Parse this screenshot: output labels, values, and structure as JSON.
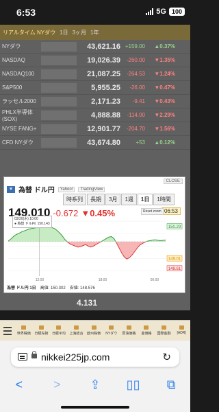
{
  "status": {
    "time": "6:53",
    "network": "5G",
    "battery": "100"
  },
  "background": {
    "header": {
      "title": "リアルタイム NYダウ",
      "options": [
        "1日",
        "3ヶ月",
        "1年"
      ]
    },
    "rows": [
      {
        "name": "NYダウ",
        "price": "43,621.16",
        "change": "+159.00",
        "pct": "▲0.37%",
        "dir": "up"
      },
      {
        "name": "NASDAQ",
        "price": "19,026.39",
        "change": "-260.00",
        "pct": "▼1.35%",
        "dir": "dn"
      },
      {
        "name": "NASDAQ100",
        "price": "21,087.25",
        "change": "-264.53",
        "pct": "▼1.24%",
        "dir": "dn"
      },
      {
        "name": "S&P500",
        "price": "5,955.25",
        "change": "-26.00",
        "pct": "▼0.47%",
        "dir": "dn"
      },
      {
        "name": "ラッセル2000",
        "price": "2,171.23",
        "change": "-9.41",
        "pct": "▼0.43%",
        "dir": "dn"
      },
      {
        "name": "PHLX半導体(SOX)",
        "price": "4,888.88",
        "change": "-114.00",
        "pct": "▼2.29%",
        "dir": "dn"
      },
      {
        "name": "NYSE FANG+",
        "price": "12,901.77",
        "change": "-204.70",
        "pct": "▼1.56%",
        "dir": "dn"
      },
      {
        "name": "CFD NYダウ",
        "price": "43,674.80",
        "change": "+53",
        "pct": "▲0.12%",
        "dir": "up"
      }
    ],
    "below_value": "4.131"
  },
  "modal": {
    "close_label": "CLOSE",
    "title": "為替 ドル円",
    "sources": [
      "Yahoo!",
      "TradingView"
    ],
    "tabs": [
      "時系列",
      "長期",
      "3月",
      "1週",
      "1日",
      "1時間"
    ],
    "active_tab": "1日",
    "price": "149.010",
    "change": "-0.672",
    "pct": "▼0.45%",
    "time": "06:53",
    "info_lines": [
      "03/20(木) 10:00",
      "● 為替 ドル円: 150.143"
    ],
    "reset_label": "Reset zoom",
    "footer_label": "為替 ドル円 1日",
    "high": "高値: 150.302",
    "low": "安値: 148.576"
  },
  "chart_data": {
    "type": "area",
    "title": "",
    "xlabel": "",
    "ylabel": "",
    "xlabels": [
      "12:00",
      "18:00",
      "00:00"
    ],
    "ylim": [
      148.3,
      150.5
    ],
    "ytick_labels": [
      "150.5",
      "150",
      "149.5",
      "149",
      "148.5"
    ],
    "flag_labels": [
      "150.29",
      "149.01",
      "148.61"
    ],
    "baseline": 149.68,
    "y": [
      149.7,
      149.78,
      149.88,
      149.96,
      150.0,
      150.06,
      150.1,
      150.14,
      150.18,
      150.2,
      150.22,
      150.24,
      150.25,
      150.26,
      150.28,
      150.27,
      150.26,
      150.24,
      150.2,
      150.12,
      150.02,
      149.9,
      149.76,
      149.66,
      149.58,
      149.54,
      149.5,
      149.46,
      149.48,
      149.52,
      149.56,
      149.5,
      149.46,
      149.5,
      149.56,
      149.62,
      149.68,
      149.74,
      149.8,
      149.86,
      149.88,
      149.8,
      149.62,
      149.42,
      149.22,
      149.06,
      148.98,
      149.04,
      149.14,
      149.28,
      149.42,
      149.54,
      149.6,
      149.66,
      149.7,
      149.72,
      149.74,
      149.75,
      149.73,
      149.72,
      149.73,
      149.74
    ]
  },
  "site_nav": {
    "items": [
      "世界株価",
      "日経先物",
      "日経平均",
      "上海総合",
      "欧州株価",
      "NYダウ",
      "原油価格",
      "金価格",
      "国際金融",
      "[ADR]"
    ]
  },
  "browser": {
    "url": "nikkei225jp.com"
  }
}
